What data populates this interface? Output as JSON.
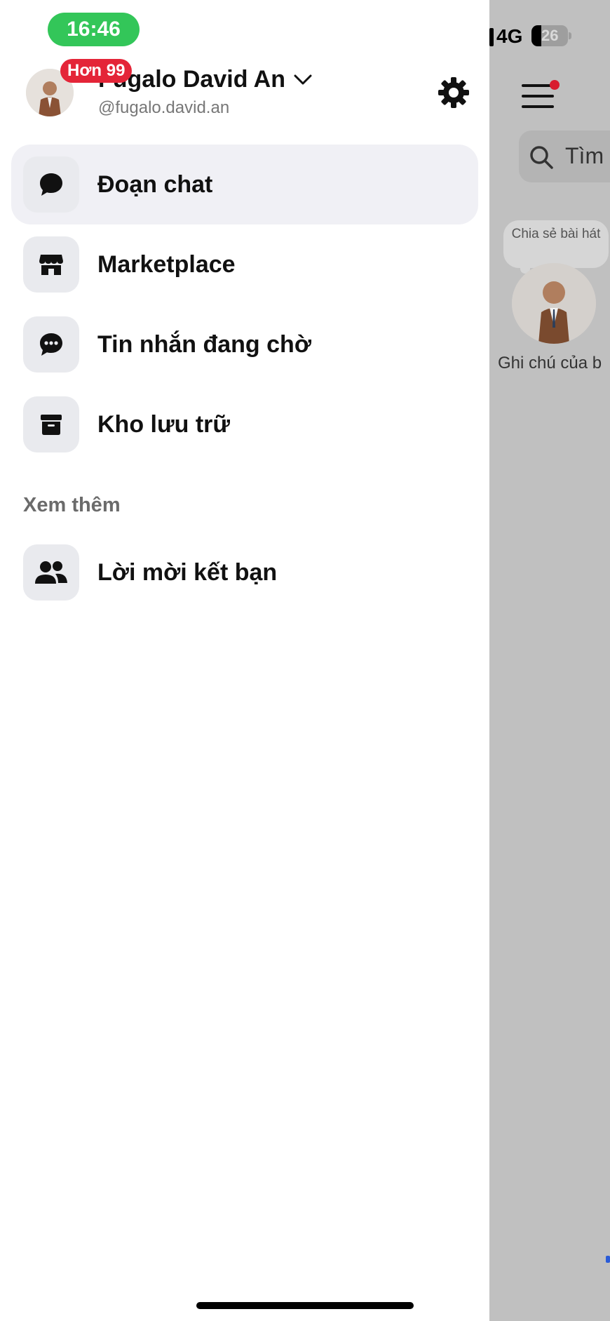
{
  "status_bar": {
    "time": "16:46",
    "network": "4G",
    "battery": "26"
  },
  "profile": {
    "name": "Fugalo David An",
    "handle": "@fugalo.david.an",
    "badge": "Hơn 99"
  },
  "menu": {
    "items": [
      {
        "label": "Đoạn chat",
        "icon": "chat-bubble-icon",
        "active": true
      },
      {
        "label": "Marketplace",
        "icon": "store-icon",
        "active": false
      },
      {
        "label": "Tin nhắn đang chờ",
        "icon": "message-dots-icon",
        "active": false
      },
      {
        "label": "Kho lưu trữ",
        "icon": "archive-box-icon",
        "active": false
      }
    ],
    "section_title": "Xem thêm",
    "more_items": [
      {
        "label": "Lời mời kết bạn",
        "icon": "people-icon"
      }
    ]
  },
  "background_app": {
    "search_text": "Tìm",
    "note_bubble": "Chia sẻ bài hát",
    "note_caption": "Ghi chú của b"
  },
  "colors": {
    "time_pill": "#33c659",
    "badge": "#e42538",
    "active_item": "#f0f0f5",
    "icon_tile": "#e9eaee",
    "overlay": "#c0c0c0"
  }
}
